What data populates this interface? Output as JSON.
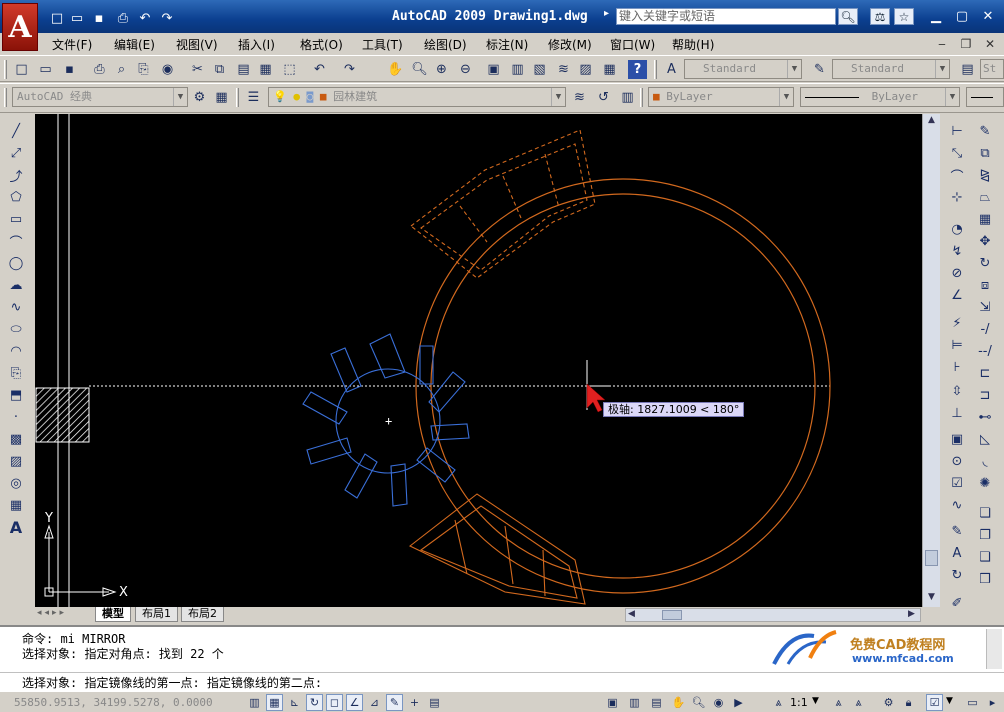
{
  "app": {
    "logo_letter": "A",
    "title": "AutoCAD 2009 Drawing1.dwg",
    "search_placeholder": "键入关键字或短语"
  },
  "menu": {
    "items": [
      "文件(F)",
      "编辑(E)",
      "视图(V)",
      "插入(I)",
      "格式(O)",
      "工具(T)",
      "绘图(D)",
      "标注(N)",
      "修改(M)",
      "窗口(W)",
      "帮助(H)"
    ]
  },
  "toolbar": {
    "text_style": "Standard",
    "dim_style": "Standard",
    "table_style_partial": "St",
    "workspace": "AutoCAD 经典",
    "layer": "园林建筑",
    "color": "ByLayer",
    "linetype": "ByLayer"
  },
  "canvas": {
    "polar_tooltip": "极轴: 1827.1009 < 180°",
    "ucs_x_label": "X",
    "ucs_y_label": "Y",
    "colors": {
      "background": "#000000",
      "orange": "#d2691e",
      "blue": "#3a6fd8",
      "white": "#ffffff"
    }
  },
  "tabs": {
    "items": [
      "模型",
      "布局1",
      "布局2"
    ],
    "active": "模型"
  },
  "command": {
    "lines": [
      "命令: mi MIRROR",
      "选择对象: 指定对角点: 找到 22 个",
      "选择对象:  指定镜像线的第一点: 指定镜像线的第二点:"
    ]
  },
  "watermark": {
    "name": "免费CAD教程网",
    "url": "www.mfcad.com"
  },
  "status": {
    "coordinates": "55850.9513, 34199.5278, 0.0000",
    "scale": "1:1"
  }
}
